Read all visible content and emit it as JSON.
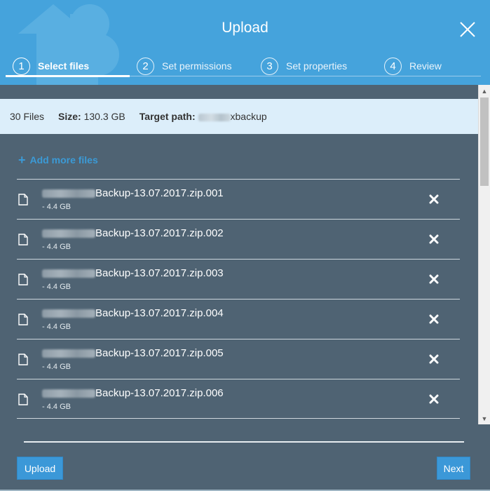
{
  "window": {
    "title": "Upload"
  },
  "steps": [
    {
      "num": "1",
      "label": "Select files",
      "active": true
    },
    {
      "num": "2",
      "label": "Set permissions",
      "active": false
    },
    {
      "num": "3",
      "label": "Set properties",
      "active": false
    },
    {
      "num": "4",
      "label": "Review",
      "active": false
    }
  ],
  "summary": {
    "files": "30 Files",
    "size_label": "Size:",
    "size_value": "130.3 GB",
    "target_label": "Target path:",
    "target_value": "xbackup"
  },
  "add_more": {
    "label": "Add more files"
  },
  "files": [
    {
      "name": "Backup-13.07.2017.zip.001",
      "size": "- 4.4 GB"
    },
    {
      "name": "Backup-13.07.2017.zip.002",
      "size": "- 4.4 GB"
    },
    {
      "name": "Backup-13.07.2017.zip.003",
      "size": "- 4.4 GB"
    },
    {
      "name": "Backup-13.07.2017.zip.004",
      "size": "- 4.4 GB"
    },
    {
      "name": "Backup-13.07.2017.zip.005",
      "size": "- 4.4 GB"
    },
    {
      "name": "Backup-13.07.2017.zip.006",
      "size": "- 4.4 GB"
    }
  ],
  "footer": {
    "upload_label": "Upload",
    "next_label": "Next"
  },
  "icons": {
    "close": "close-icon",
    "file": "file-icon",
    "remove": "remove-icon",
    "plus": "plus-icon"
  },
  "colors": {
    "header": "#45a3dc",
    "body": "#4f6373",
    "summary": "#dceefa",
    "accent": "#3b98d8"
  }
}
